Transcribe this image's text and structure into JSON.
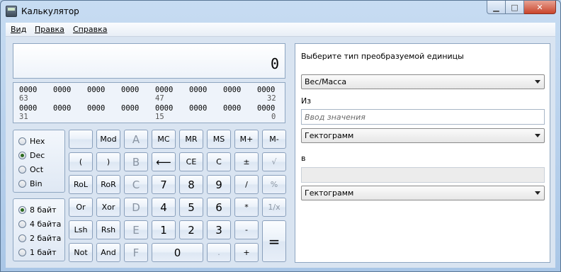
{
  "window": {
    "title": "Калькулятор",
    "minimize_glyph": "▁",
    "maximize_glyph": "□",
    "close_glyph": "✕"
  },
  "menu": [
    "Вид",
    "Правка",
    "Справка"
  ],
  "display": {
    "value": "0"
  },
  "bits": {
    "row1": [
      "0000",
      "0000",
      "0000",
      "0000",
      "0000",
      "0000",
      "0000",
      "0000"
    ],
    "row1_labels": [
      "63",
      "47",
      "32"
    ],
    "row2": [
      "0000",
      "0000",
      "0000",
      "0000",
      "0000",
      "0000",
      "0000",
      "0000"
    ],
    "row2_labels": [
      "31",
      "15",
      "0"
    ]
  },
  "number_base": {
    "options": [
      "Hex",
      "Dec",
      "Oct",
      "Bin"
    ],
    "selected": "Dec"
  },
  "word_size": {
    "options": [
      "8 байт",
      "4 байта",
      "2 байта",
      "1 байт"
    ],
    "selected": "8 байт"
  },
  "keys": {
    "blank": "",
    "mod": "Mod",
    "A": "A",
    "MC": "MC",
    "MR": "MR",
    "MS": "MS",
    "Mplus": "M+",
    "Mminus": "M-",
    "lparen": "(",
    "rparen": ")",
    "B": "B",
    "back": "⟵",
    "CE": "CE",
    "C": "C",
    "plusminus": "±",
    "sqrt": "√",
    "RoL": "RoL",
    "RoR": "RoR",
    "Ckey": "C",
    "d7": "7",
    "d8": "8",
    "d9": "9",
    "div": "/",
    "pct": "%",
    "Or": "Or",
    "Xor": "Xor",
    "D": "D",
    "d4": "4",
    "d5": "5",
    "d6": "6",
    "mul": "*",
    "inv": "1/x",
    "Lsh": "Lsh",
    "Rsh": "Rsh",
    "E": "E",
    "d1": "1",
    "d2": "2",
    "d3": "3",
    "minus": "-",
    "eq": "=",
    "Not": "Not",
    "And": "And",
    "F": "F",
    "d0": "0",
    "dot": ".",
    "plus": "+"
  },
  "converter": {
    "heading": "Выберите тип преобразуемой единицы",
    "type_value": "Вес/Масса",
    "from_label": "Из",
    "input_placeholder": "Ввод значения",
    "from_unit": "Гектограмм",
    "to_label": "в",
    "to_unit": "Гектограмм"
  }
}
